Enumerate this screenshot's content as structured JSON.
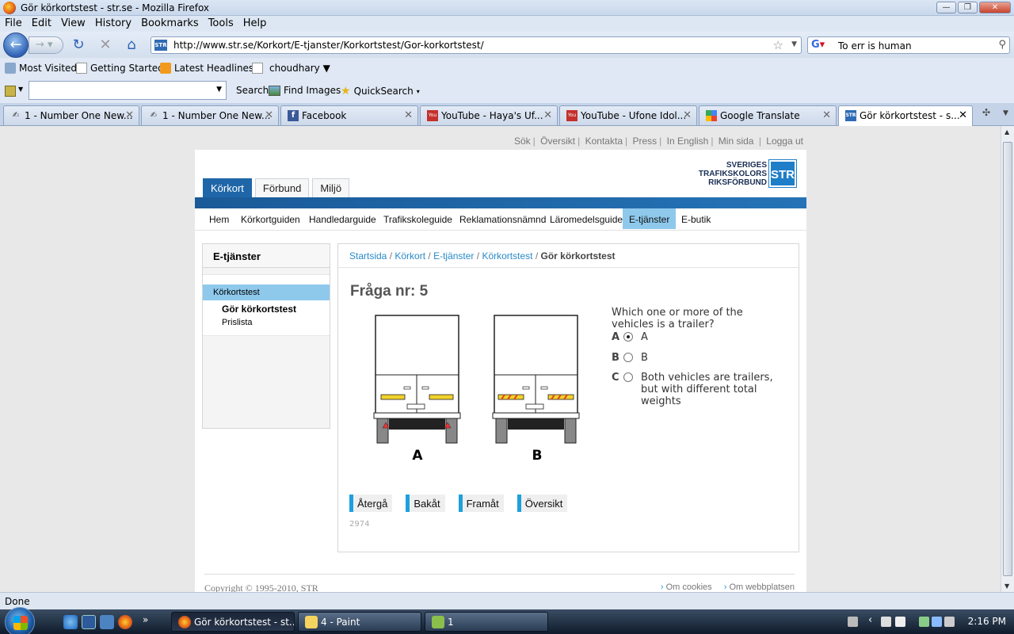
{
  "window": {
    "title": "Gör körkortstest - str.se - Mozilla Firefox"
  },
  "menu": [
    "File",
    "Edit",
    "View",
    "History",
    "Bookmarks",
    "Tools",
    "Help"
  ],
  "address": {
    "url": "http://www.str.se/Korkort/E-tjanster/Korkortstest/Gor-korkortstest/",
    "site_icon": "STR"
  },
  "search": {
    "value": "To err is human"
  },
  "bookmarks": [
    "Most Visited",
    "Getting Started",
    "Latest Headlines",
    "choudhary ▼"
  ],
  "toolbar2": {
    "search": "Search",
    "find_images": "Find Images",
    "quicksearch": "QuickSearch"
  },
  "tabs": [
    {
      "label": "1 - Number One New..."
    },
    {
      "label": "1 - Number One New..."
    },
    {
      "label": "Facebook"
    },
    {
      "label": "YouTube - Haya's Uf..."
    },
    {
      "label": "YouTube - Ufone Idol..."
    },
    {
      "label": "Google Translate"
    },
    {
      "label": "Gör körkortstest - s..."
    }
  ],
  "page": {
    "toplinks": [
      "Sök",
      "Översikt",
      "Kontakta",
      "Press",
      "In English",
      "Min sida",
      "Logga ut"
    ],
    "logo": {
      "line1": "SVERIGES",
      "line2": "TRAFIKSKOLORS",
      "line3": "RIKSFÖRBUND",
      "mark": "STR"
    },
    "main_tabs": [
      "Körkort",
      "Förbund",
      "Miljö"
    ],
    "subnav": [
      "Hem",
      "Körkortguiden",
      "Handledarguide",
      "Trafikskoleguide",
      "Reklamationsnämnd",
      "Läromedelsguide",
      "E-tjänster",
      "E-butik"
    ],
    "sidebar": {
      "title": "E-tjänster",
      "selected": "Körkortstest",
      "sub1": "Gör körkortstest",
      "sub2": "Prislista"
    },
    "breadcrumb": {
      "b1": "Startsida",
      "b2": "Körkort",
      "b3": "E-tjänster",
      "b4": "Körkortstest",
      "current": "Gör körkortstest"
    },
    "question": {
      "title": "Fråga nr: 5",
      "text": "Which one or more of the vehicles is a trailer?",
      "label_a": "A",
      "label_b": "B",
      "options": [
        {
          "letter": "A",
          "label": "A",
          "selected": true
        },
        {
          "letter": "B",
          "label": "B",
          "selected": false
        },
        {
          "letter": "C",
          "label": "Both vehicles are trailers, but with different total weights",
          "selected": false
        }
      ],
      "id": "2974"
    },
    "buttons": [
      "Återgå",
      "Bakåt",
      "Framåt",
      "Översikt"
    ],
    "footer": {
      "copyright": "Copyright © 1995-2010, STR",
      "link1": "Om cookies",
      "link2": "Om webbplatsen"
    }
  },
  "status": "Done",
  "taskbar": {
    "tasks": [
      "Gör körkortstest - st...",
      "4 - Paint",
      "1"
    ],
    "clock": "2:16 PM"
  },
  "colors": {
    "str_blue": "#1f66a8",
    "active_nav": "#8ec9ec",
    "button_accent": "#1ea0dc"
  }
}
